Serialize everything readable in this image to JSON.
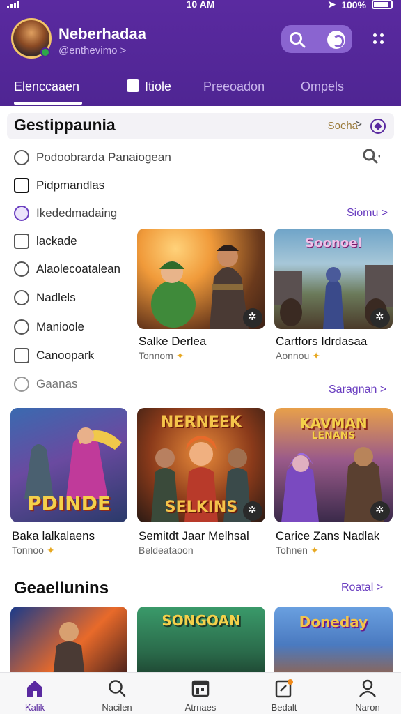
{
  "status_bar": {
    "time": "10 AM",
    "battery": "100%"
  },
  "header": {
    "user_name": "Neberhadaa",
    "user_handle": "@enthevimo >"
  },
  "tabs": [
    {
      "label": "Elenccaaen",
      "active": true
    },
    {
      "label": "Itiole",
      "active": false
    },
    {
      "label": "Preeoadon",
      "active": false
    },
    {
      "label": "Ompels",
      "active": false
    }
  ],
  "section1": {
    "title": "Gestippaunia",
    "link": "Soeha",
    "link_chevron": ">"
  },
  "menu": [
    {
      "label": "Podoobrarda Panaiogean",
      "icon": "search-user-icon"
    },
    {
      "label": "Pidpmandlas",
      "icon": "flag-icon"
    },
    {
      "label": "Ikededmadaing",
      "icon": "circle-icon"
    },
    {
      "label": "lackade",
      "icon": "bookmark-icon"
    },
    {
      "label": "Alaolecoatalean",
      "icon": "trophy-icon"
    },
    {
      "label": "Nadlels",
      "icon": "location-icon"
    },
    {
      "label": "Manioole",
      "icon": "refresh-icon"
    },
    {
      "label": "Canoopark",
      "icon": "card-icon"
    },
    {
      "label": "Gaanas",
      "icon": "target-icon"
    }
  ],
  "links": {
    "row1_more": "Siomu >",
    "row2_more": "Saragnan >",
    "section2_more": "Roatal >"
  },
  "cards_row1": [
    {
      "title": "Salke Derlea",
      "sub": "Tonnom"
    },
    {
      "title": "Cartfors Idrdasaa",
      "sub": "Aonnou",
      "art_text": "Soonoel"
    }
  ],
  "cards_row2": [
    {
      "title": "Baka lalkalaens",
      "sub": "Tonnoo",
      "art_text": "PDINDE"
    },
    {
      "title": "Semitdt Jaar Melhsal",
      "sub": "Beldeataoon",
      "art_top": "NERNEEK",
      "art_bottom": "SELKINS"
    },
    {
      "title": "Carice Zans Nadlak",
      "sub": "Tohnen",
      "art_top": "KAVMAN",
      "art_bottom": "LENANS"
    }
  ],
  "section2": {
    "title": "Geaellunins",
    "cards": [
      {
        "art_text": ""
      },
      {
        "art_text": "SONGOAN"
      },
      {
        "art_text": "Doneday"
      }
    ]
  },
  "bottom_nav": [
    {
      "label": "Kalik",
      "icon": "home-icon",
      "active": true
    },
    {
      "label": "Nacilen",
      "icon": "search-icon",
      "active": false
    },
    {
      "label": "Atrnaes",
      "icon": "calendar-icon",
      "active": false
    },
    {
      "label": "Bedalt",
      "icon": "edit-icon",
      "active": false
    },
    {
      "label": "Naron",
      "icon": "profile-icon",
      "active": false
    }
  ],
  "colors": {
    "brand": "#5a2aa0",
    "accent": "#6a3ec0"
  }
}
